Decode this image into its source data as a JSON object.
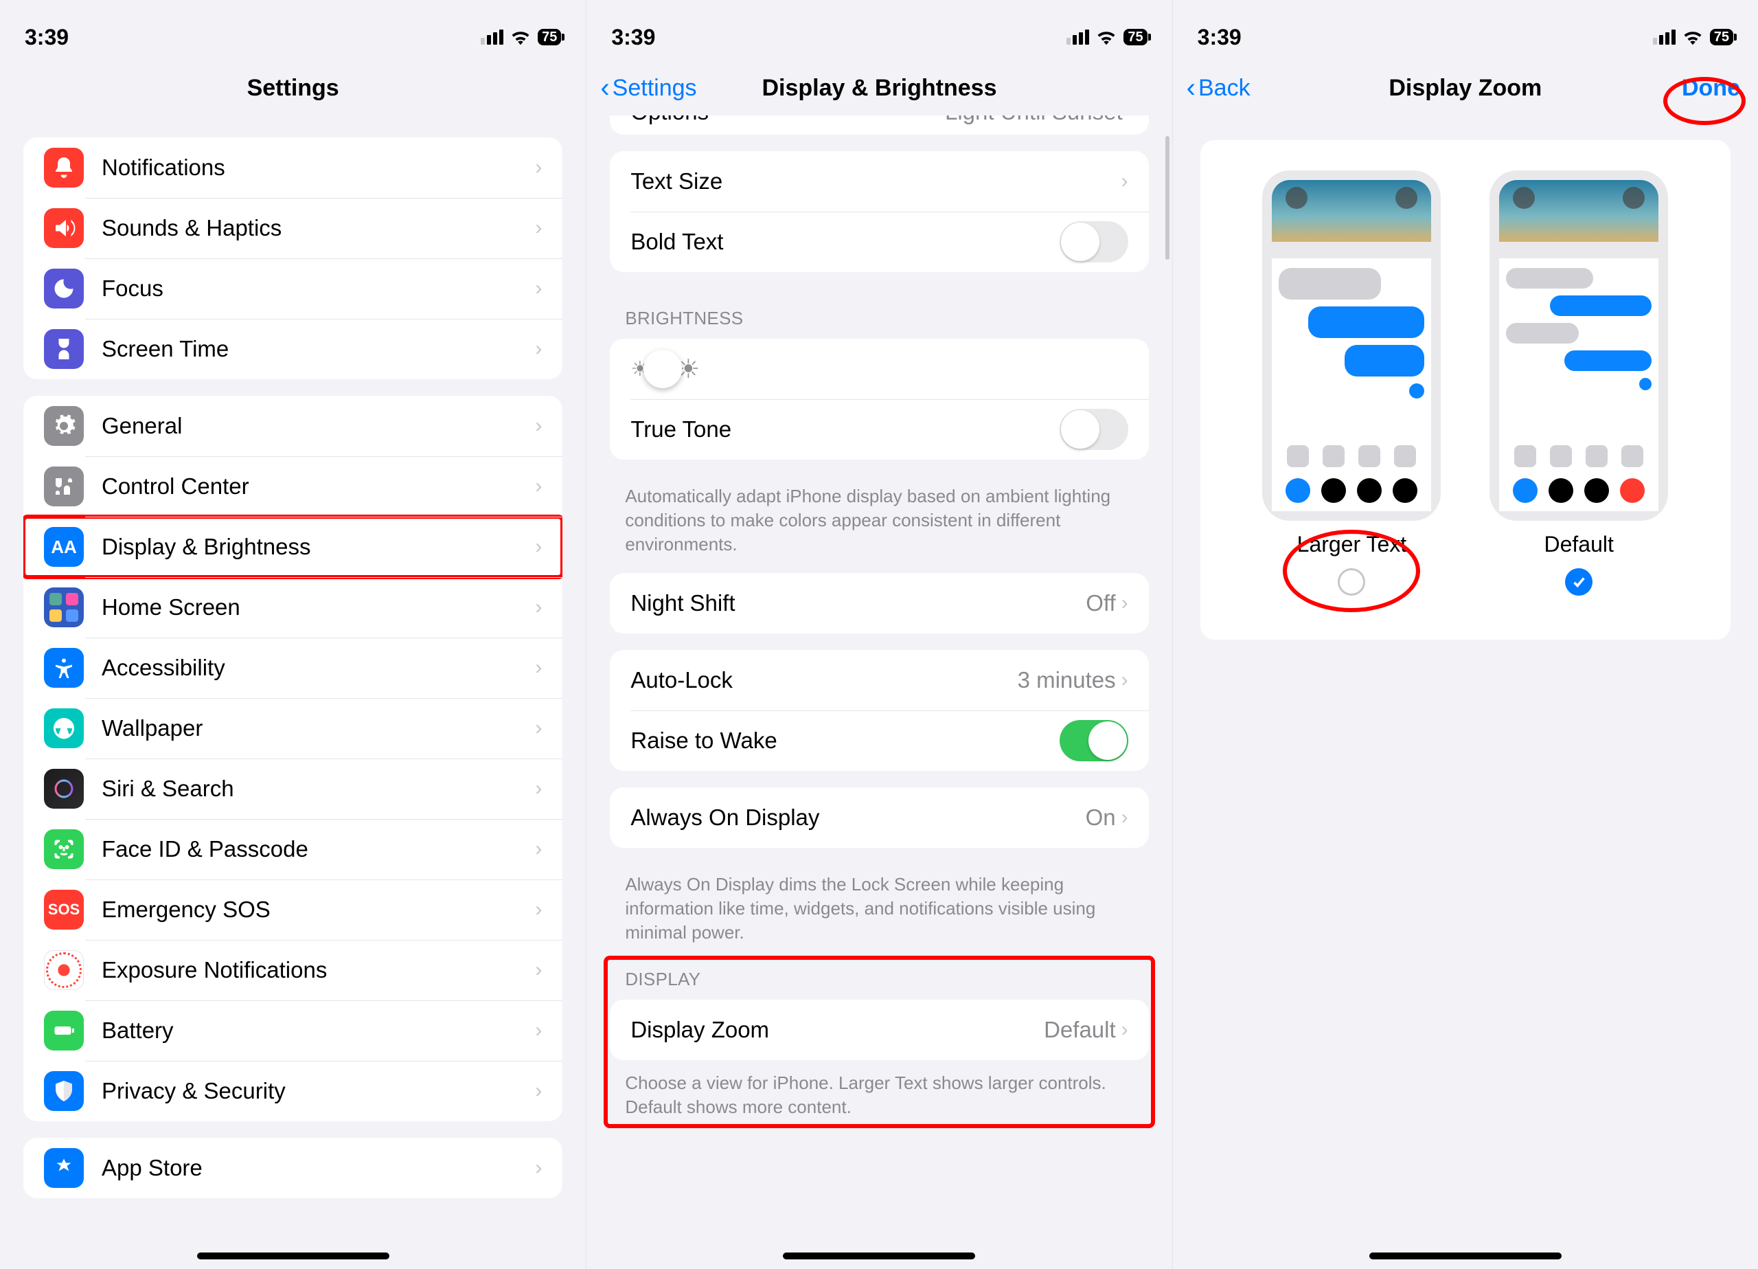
{
  "status": {
    "time": "3:39",
    "battery": "75"
  },
  "pane1": {
    "title": "Settings",
    "partial_item": "Options",
    "groups": [
      {
        "items": [
          {
            "id": "notifications",
            "label": "Notifications",
            "color": "ic-notifications"
          },
          {
            "id": "sounds",
            "label": "Sounds & Haptics",
            "color": "ic-sounds"
          },
          {
            "id": "focus",
            "label": "Focus",
            "color": "ic-focus"
          },
          {
            "id": "screentime",
            "label": "Screen Time",
            "color": "ic-screentime"
          }
        ]
      },
      {
        "items": [
          {
            "id": "general",
            "label": "General",
            "color": "ic-general"
          },
          {
            "id": "controlcenter",
            "label": "Control Center",
            "color": "ic-controlcenter"
          },
          {
            "id": "display",
            "label": "Display & Brightness",
            "color": "ic-display",
            "highlight": true
          },
          {
            "id": "home",
            "label": "Home Screen",
            "color": "ic-home"
          },
          {
            "id": "accessibility",
            "label": "Accessibility",
            "color": "ic-accessibility"
          },
          {
            "id": "wallpaper",
            "label": "Wallpaper",
            "color": "ic-wallpaper"
          },
          {
            "id": "siri",
            "label": "Siri & Search",
            "color": "ic-siri"
          },
          {
            "id": "faceid",
            "label": "Face ID & Passcode",
            "color": "ic-faceid"
          },
          {
            "id": "sos",
            "label": "Emergency SOS",
            "color": "ic-sos"
          },
          {
            "id": "exposure",
            "label": "Exposure Notifications",
            "color": "ic-exposure"
          },
          {
            "id": "battery",
            "label": "Battery",
            "color": "ic-battery"
          },
          {
            "id": "privacy",
            "label": "Privacy & Security",
            "color": "ic-privacy"
          }
        ]
      },
      {
        "items": [
          {
            "id": "appstore",
            "label": "App Store",
            "color": "ic-appstore"
          }
        ]
      }
    ]
  },
  "pane2": {
    "back": "Settings",
    "title": "Display & Brightness",
    "partial_item_label": "Options",
    "partial_item_value": "Light Until Sunset",
    "text_size": "Text Size",
    "bold_text": "Bold Text",
    "brightness_header": "BRIGHTNESS",
    "true_tone": "True Tone",
    "true_tone_footer": "Automatically adapt iPhone display based on ambient lighting conditions to make colors appear consistent in different environments.",
    "night_shift": "Night Shift",
    "night_shift_value": "Off",
    "auto_lock": "Auto-Lock",
    "auto_lock_value": "3 minutes",
    "raise_wake": "Raise to Wake",
    "always_on": "Always On Display",
    "always_on_value": "On",
    "always_on_footer": "Always On Display dims the Lock Screen while keeping information like time, widgets, and notifications visible using minimal power.",
    "display_header": "DISPLAY",
    "display_zoom": "Display Zoom",
    "display_zoom_value": "Default",
    "display_zoom_footer": "Choose a view for iPhone. Larger Text shows larger controls. Default shows more content."
  },
  "pane3": {
    "back": "Back",
    "title": "Display Zoom",
    "done": "Done",
    "larger": "Larger Text",
    "default": "Default"
  }
}
